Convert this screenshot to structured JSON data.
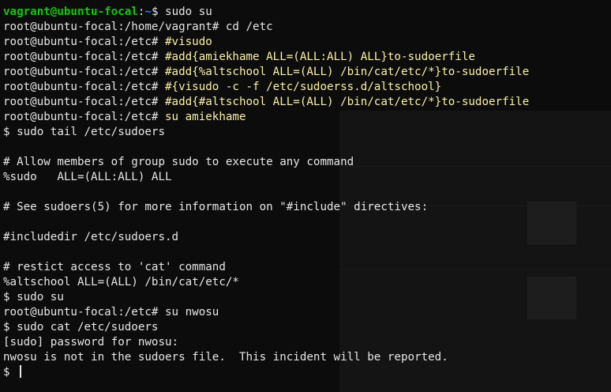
{
  "terminal": {
    "lines": [
      {
        "user": "vagrant@ubuntu-focal",
        "path": "~",
        "sym": "$",
        "cmd": " sudo su"
      },
      {
        "prompt": "root@ubuntu-focal:/home/vagrant#",
        "cmd": " cd /etc"
      },
      {
        "prompt": "root@ubuntu-focal:/etc#",
        "cmd": " #visudo"
      },
      {
        "prompt": "root@ubuntu-focal:/etc#",
        "cmd": " #add{amiekhame ALL=(ALL:ALL) ALL}to-sudoerfile"
      },
      {
        "prompt": "root@ubuntu-focal:/etc#",
        "cmd": " #add{%altschool ALL=(ALL) /bin/cat/etc/*}to-sudoerfile"
      },
      {
        "prompt": "root@ubuntu-focal:/etc#",
        "cmd": " #{visudo -c -f /etc/sudoerss.d/altschool}"
      },
      {
        "prompt": "root@ubuntu-focal:/etc#",
        "cmd": " #add{#altschool ALL=(ALL) /bin/cat/etc/*}to-sudoerfile"
      },
      {
        "prompt": "root@ubuntu-focal:/etc#",
        "cmd": " su amiekhame"
      },
      {
        "text": "$ sudo tail /etc/sudoers"
      },
      {
        "text": ""
      },
      {
        "text": "# Allow members of group sudo to execute any command"
      },
      {
        "text": "%sudo   ALL=(ALL:ALL) ALL"
      },
      {
        "text": ""
      },
      {
        "text": "# See sudoers(5) for more information on \"#include\" directives:"
      },
      {
        "text": ""
      },
      {
        "text": "#includedir /etc/sudoers.d"
      },
      {
        "text": ""
      },
      {
        "text": "# restict access to 'cat' command"
      },
      {
        "text": "%altschool ALL=(ALL) /bin/cat/etc/*"
      },
      {
        "text": "$ sudo su"
      },
      {
        "prompt": "root@ubuntu-focal:/etc#",
        "cmd": " su nwosu"
      },
      {
        "text": "$ sudo cat /etc/sudoers"
      },
      {
        "text": "[sudo] password for nwosu:"
      },
      {
        "text": "nwosu is not in the sudoers file.  This incident will be reported."
      },
      {
        "text": "$ ",
        "cursor": true
      }
    ]
  },
  "colors": {
    "background": "#0c0c0c",
    "user_prompt": "#16c60c",
    "path": "#3b78ff",
    "text": "#e6e6e6",
    "command_yellow": "#f9f1a5"
  }
}
